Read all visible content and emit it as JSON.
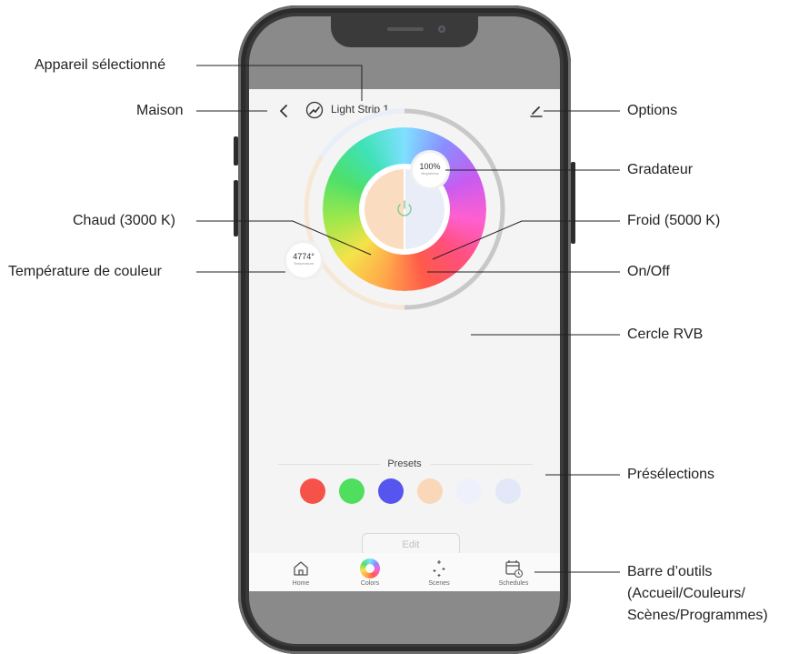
{
  "annotations": {
    "device_selected": "Appareil sélectionné",
    "home": "Maison",
    "options": "Options",
    "dimmer": "Gradateur",
    "warm": "Chaud (3000 K)",
    "cold": "Froid (5000 K)",
    "color_temperature": "Température de couleur",
    "on_off": "On/Off",
    "rgb_circle": "Cercle RVB",
    "presets": "Présélections",
    "toolbar_line1": "Barre d’outils",
    "toolbar_line2": "(Accueil/Couleurs/",
    "toolbar_line3": "Scènes/Programmes)"
  },
  "app": {
    "header": {
      "device_name": "Light Strip 1",
      "back_icon": "chevron-left-icon",
      "device_icon": "light-strip-icon",
      "edit_icon": "pencil-icon"
    },
    "brightness": {
      "value": "100%",
      "label": "Brightness",
      "level": 1.0
    },
    "temperature": {
      "value": "4774°",
      "label": "Temperature"
    },
    "power_icon": "power-icon",
    "presets": {
      "title": "Presets",
      "colors": [
        "#f5524a",
        "#4fde5e",
        "#5656ef",
        "#fad7b8",
        "#eef1fb",
        "#e2e8f7"
      ]
    },
    "edit_label": "Edit",
    "toolbar": [
      {
        "label": "Home",
        "icon": "home-icon"
      },
      {
        "label": "Colors",
        "icon": "color-wheel-icon"
      },
      {
        "label": "Scenes",
        "icon": "sparkle-icon"
      },
      {
        "label": "Schedules",
        "icon": "calendar-clock-icon"
      }
    ]
  },
  "colors": {
    "warm": "#fadcc0",
    "cold": "#e8edf8",
    "track": "#c8c8c8",
    "accent_green": "#7ecb8f"
  }
}
